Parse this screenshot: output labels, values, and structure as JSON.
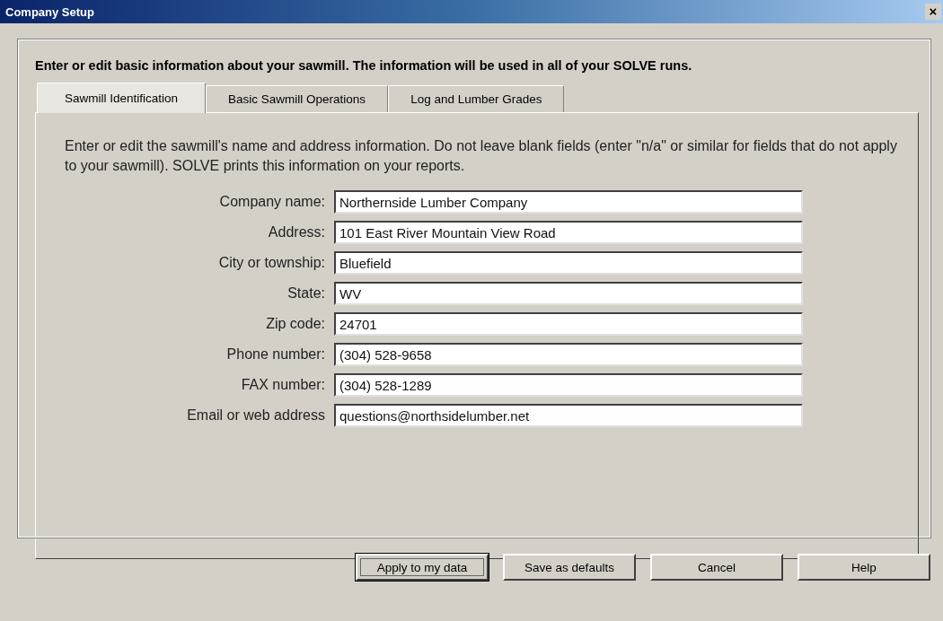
{
  "window": {
    "title": "Company Setup",
    "close": "×"
  },
  "intro": "Enter or edit basic information about your sawmill.  The information will be used in all of your SOLVE runs.",
  "tabs": [
    {
      "label": "Sawmill Identification",
      "selected": true
    },
    {
      "label": "Basic Sawmill Operations",
      "selected": false
    },
    {
      "label": "Log and Lumber Grades",
      "selected": false
    }
  ],
  "description": "Enter or edit the sawmill's name and address information.  Do not leave blank fields (enter \"n/a\" or similar for fields that do not apply to your sawmill).  SOLVE prints this information on your reports.",
  "fields": [
    {
      "label": "Company name:",
      "value": "Northernside Lumber Company"
    },
    {
      "label": "Address:",
      "value": "101 East River Mountain View Road"
    },
    {
      "label": "City or township:",
      "value": "Bluefield"
    },
    {
      "label": "State:",
      "value": "WV"
    },
    {
      "label": "Zip code:",
      "value": "24701"
    },
    {
      "label": "Phone number:",
      "value": "(304) 528-9658"
    },
    {
      "label": "FAX number:",
      "value": "(304) 528-1289"
    },
    {
      "label": "Email or web address",
      "value": "questions@northsidelumber.net"
    }
  ],
  "buttons": [
    {
      "label": "Apply to my data",
      "default": true
    },
    {
      "label": "Save as defaults",
      "default": false
    },
    {
      "label": "Cancel",
      "default": false
    },
    {
      "label": "Help",
      "default": false
    }
  ]
}
